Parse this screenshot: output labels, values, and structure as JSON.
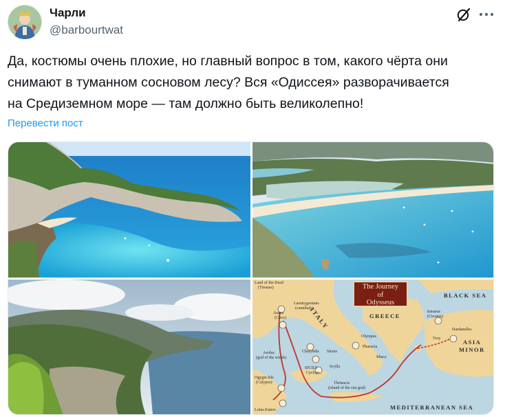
{
  "author": {
    "name": "Чарли",
    "handle": "@barbourtwat"
  },
  "tweet": {
    "text": "Да, костюмы очень плохие, но главный вопрос в том, какого чёрта они\nснимают в туманном сосновом лесу? Вся «Одиссея» разворачивается\nна Средиземном море — там должно быть великолепно!",
    "translate_label": "Перевести пост"
  },
  "icons": {
    "grok": "grok-icon",
    "more": "more-dots-icon"
  },
  "media": {
    "map": {
      "title": "The Journey\nof\nOdysseus",
      "labels": {
        "land_of_dead": "Land of the Dead",
        "tiresias": "(Tiresias)",
        "aeaea": "Aeaea",
        "circe": "(Circe)",
        "laestrygonians": "Laestrygonians",
        "cannibals": "(cannibals)",
        "italy": "ITALY",
        "greece": "GREECE",
        "ismarus": "Ismarus",
        "cicones": "(Cicones)",
        "black_sea": "BLACK SEA",
        "dardanelles": "Dardanelles",
        "troy": "Troy",
        "asia": "ASIA",
        "minor": "MINOR",
        "olympus": "Olympus",
        "phaeacia": "Phaeacia",
        "ithaca": "Ithaca",
        "aeolus": "Aeolus",
        "god_of_winds": "(god of the winds)",
        "charybdis": "Charybdis",
        "sirens": "Sirens",
        "sicily": "SICILY",
        "cyclops": "Cyclops",
        "scylla": "Scylla",
        "ogygia": "Ogygia Isle",
        "calypso": "(Calypso)",
        "thrinacia": "Thrinacia",
        "island_sun_god": "(island of the sun god)",
        "lotus_eaters": "Lotus-Eaters",
        "mediterranean": "MEDITERRANEAN SEA"
      }
    }
  }
}
